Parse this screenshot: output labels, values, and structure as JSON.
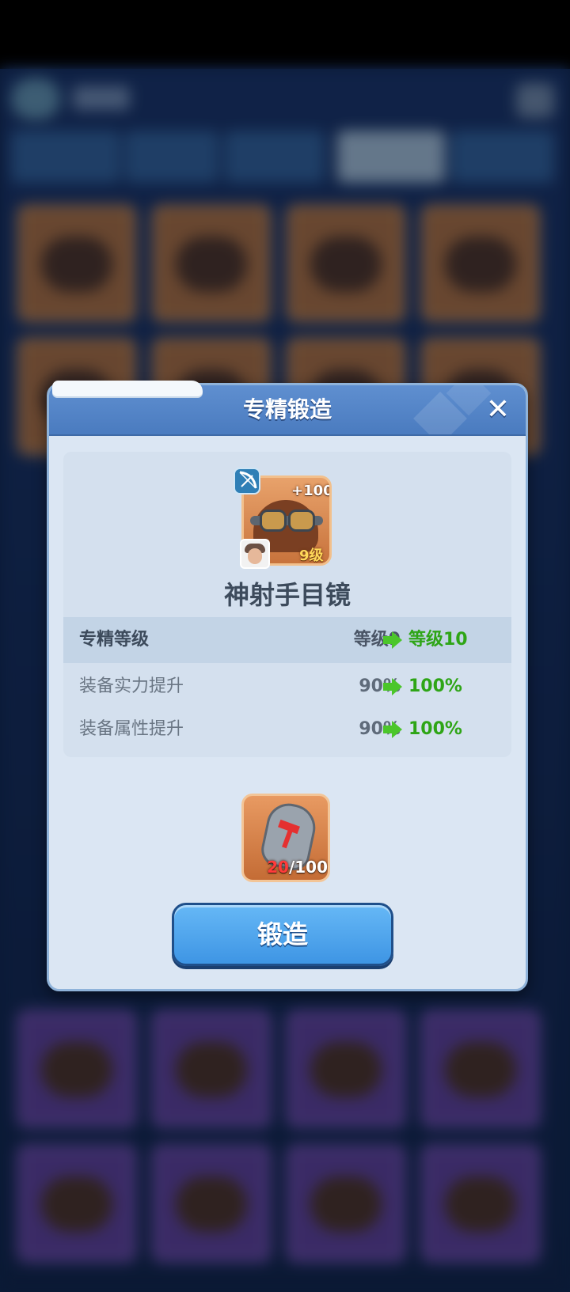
{
  "dialog": {
    "title": "专精锻造",
    "close_icon": "✕"
  },
  "item": {
    "name": "神射手目镜",
    "bonus": "+100",
    "level": "9级",
    "class_icon": "bow-icon",
    "hero_icon": "hero-portrait"
  },
  "stats": [
    {
      "label": "专精等级",
      "from": "等级9",
      "to": "等级10"
    },
    {
      "label": "装备实力提升",
      "from": "90%",
      "to": "100%"
    },
    {
      "label": "装备属性提升",
      "from": "90%",
      "to": "100%"
    }
  ],
  "material": {
    "icon": "forge-stone-icon",
    "have": "20",
    "need": "/100"
  },
  "forge_button": {
    "label": "锻造"
  },
  "colors": {
    "header": "#4a7bbf",
    "panel": "#dbe6f3",
    "increase": "#2ea516",
    "insufficient": "#ff3b3b",
    "button": "#3e95e4"
  }
}
